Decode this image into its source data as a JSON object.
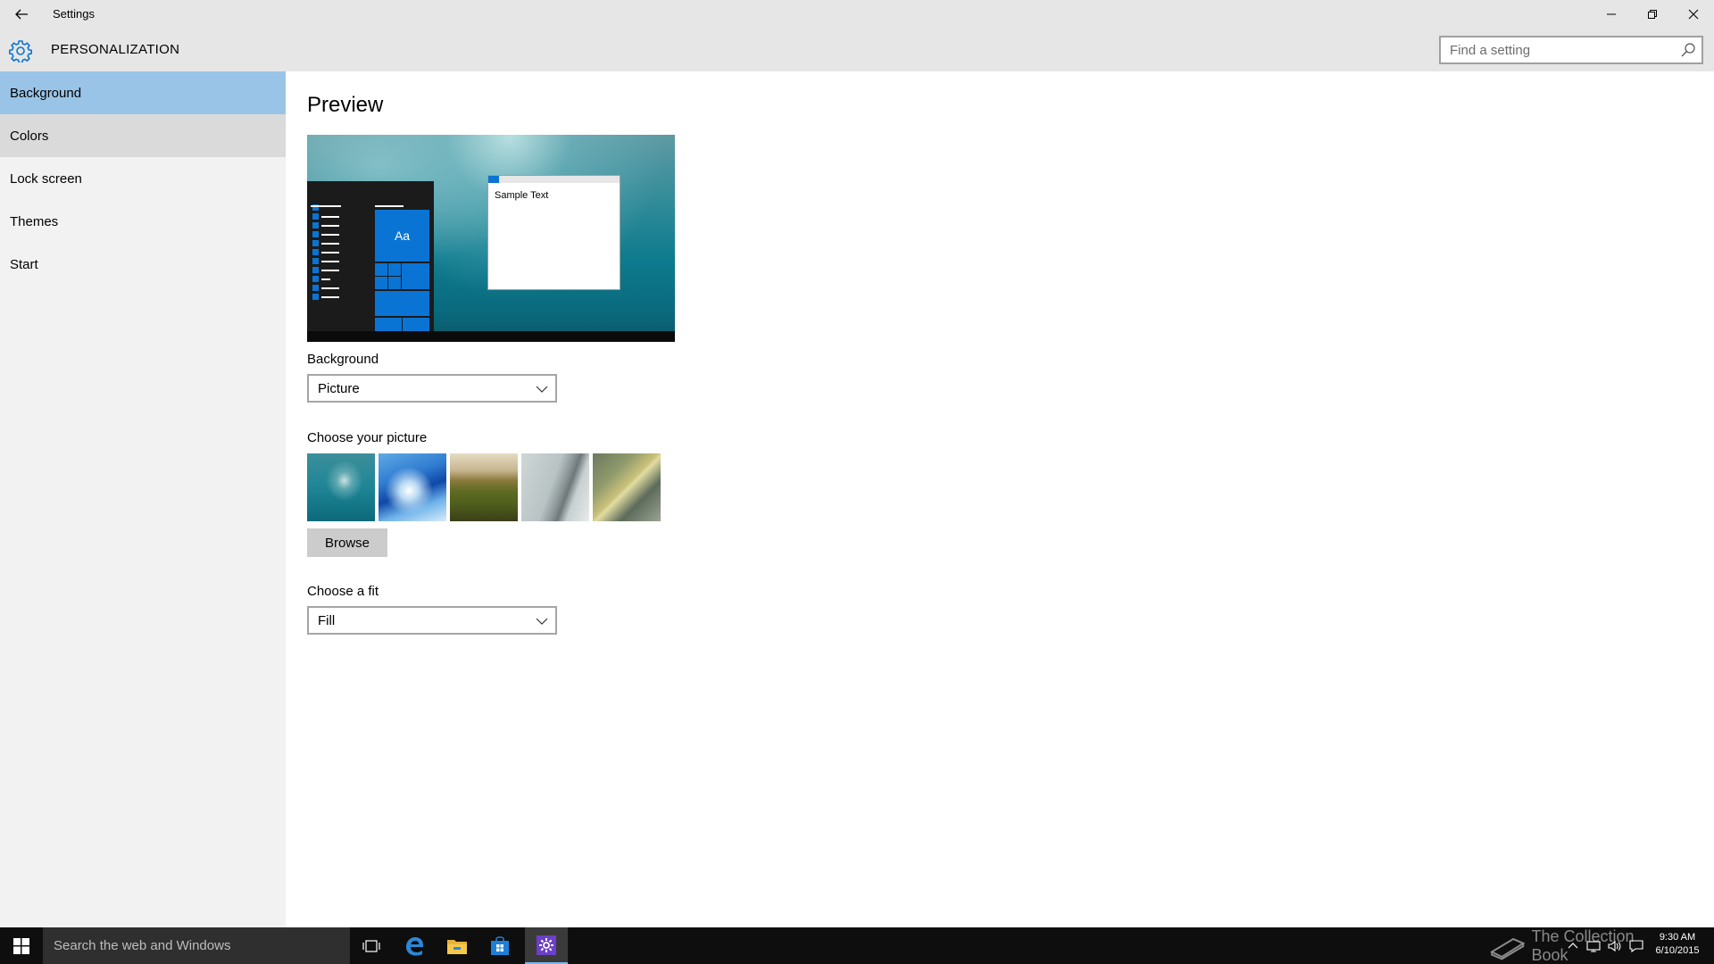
{
  "window": {
    "title": "Settings"
  },
  "header": {
    "title": "PERSONALIZATION",
    "search_placeholder": "Find a setting"
  },
  "sidebar": {
    "items": [
      {
        "label": "Background",
        "state": "selected"
      },
      {
        "label": "Colors",
        "state": "hover"
      },
      {
        "label": "Lock screen",
        "state": "normal"
      },
      {
        "label": "Themes",
        "state": "normal"
      },
      {
        "label": "Start",
        "state": "normal"
      }
    ]
  },
  "main": {
    "preview_title": "Preview",
    "preview": {
      "tile_label": "Aa",
      "sample_text": "Sample Text"
    },
    "background": {
      "label": "Background",
      "selected": "Picture"
    },
    "choose_picture": {
      "label": "Choose your picture",
      "thumbnails": [
        "underwater-swimmer",
        "blue-abstract-wave",
        "green-hills-landscape",
        "grey-coastal-road",
        "aerial-sand-water"
      ]
    },
    "browse_label": "Browse",
    "fit": {
      "label": "Choose a fit",
      "selected": "Fill"
    }
  },
  "taskbar": {
    "search_text": "Search the web and Windows",
    "icons": [
      "task-view-icon",
      "edge-icon",
      "file-explorer-icon",
      "store-icon",
      "settings-icon"
    ],
    "watermark": "The Collection Book",
    "time": "9:30 AM",
    "date": "6/10/2015"
  },
  "colors": {
    "accent": "#0a74d4",
    "selected_nav": "#99c4e8",
    "chrome": "#e6e6e6",
    "sidebar": "#f2f2f2",
    "taskbar": "#0e0e0e"
  }
}
